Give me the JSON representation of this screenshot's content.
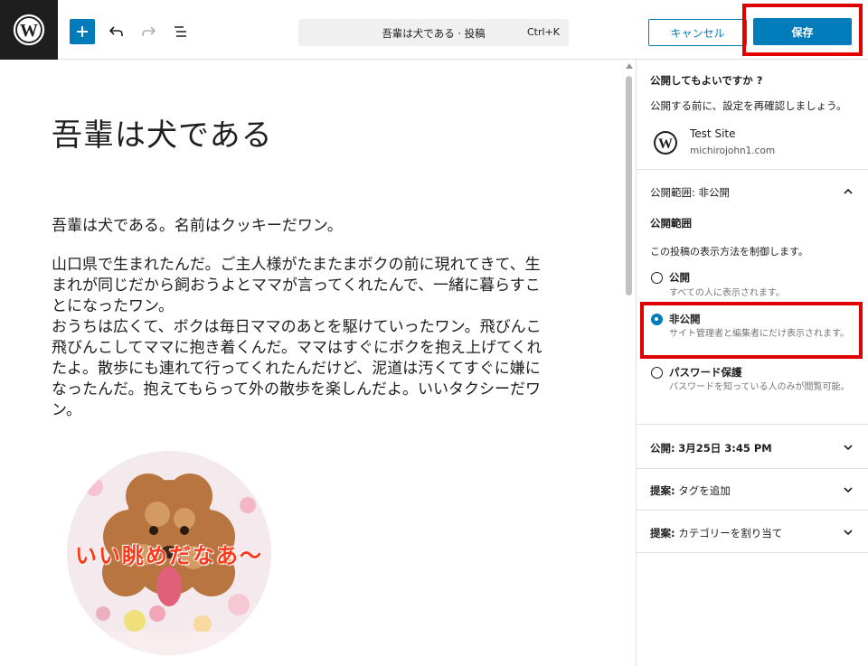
{
  "toolbar": {
    "document_title": "吾輩は犬である · 投稿",
    "shortcut": "Ctrl+K",
    "cancel_label": "キャンセル",
    "save_label": "保存"
  },
  "post": {
    "title": "吾輩は犬である",
    "paragraph1": "吾輩は犬である。名前はクッキーだワン。",
    "paragraph2_lines": [
      "山口県で生まれたんだ。ご主人様がたまたまボクの前に現れてきて、生",
      "まれが同じだから飼おうよとママが言ってくれたんで、一緒に暮らすこ",
      "とになったワン。",
      "おうちは広くて、ボクは毎日ママのあとを駆けていったワン。飛びんこ",
      "飛びんこしてママに抱き着くんだ。ママはすぐにボクを抱え上げてくれ",
      "たよ。散歩にも連れて行ってくれたんだけど、泥道は汚くてすぐに嫌に",
      "なったんだ。抱えてもらって外の散歩を楽しんだよ。いいタクシーだワ",
      "ン。"
    ],
    "image_caption": "いい眺めだなあ〜"
  },
  "sidebar": {
    "heading": "公開してもよいですか ?",
    "description": "公開する前に、設定を再確認しましょう。",
    "site_name": "Test Site",
    "site_url": "michirojohn1.com",
    "visibility_panel": {
      "label": "公開範囲:",
      "value": "非公開",
      "title": "公開範囲",
      "help": "この投稿の表示方法を制御します。",
      "options": [
        {
          "label": "公開",
          "help": "すべての人に表示されます。",
          "checked": false
        },
        {
          "label": "非公開",
          "help": "サイト管理者と編集者にだけ表示されます。",
          "checked": true
        },
        {
          "label": "パスワード保護",
          "help": "パスワードを知っている人のみが閲覧可能。",
          "checked": false
        }
      ]
    },
    "publish_panel": {
      "label": "公開:",
      "value": "3月25日 3:45 PM"
    },
    "tags_panel": {
      "label": "提案:",
      "value": "タグを追加"
    },
    "category_panel": {
      "label": "提案:",
      "value": "カテゴリーを割り当て"
    }
  },
  "colors": {
    "accent": "#007cba",
    "highlight": "#e00000",
    "caption": "#ff3a1a"
  },
  "icons": [
    "wordpress-logo-icon",
    "plus-icon",
    "undo-icon",
    "redo-icon",
    "list-view-icon",
    "chevron-up-icon",
    "chevron-down-icon"
  ]
}
